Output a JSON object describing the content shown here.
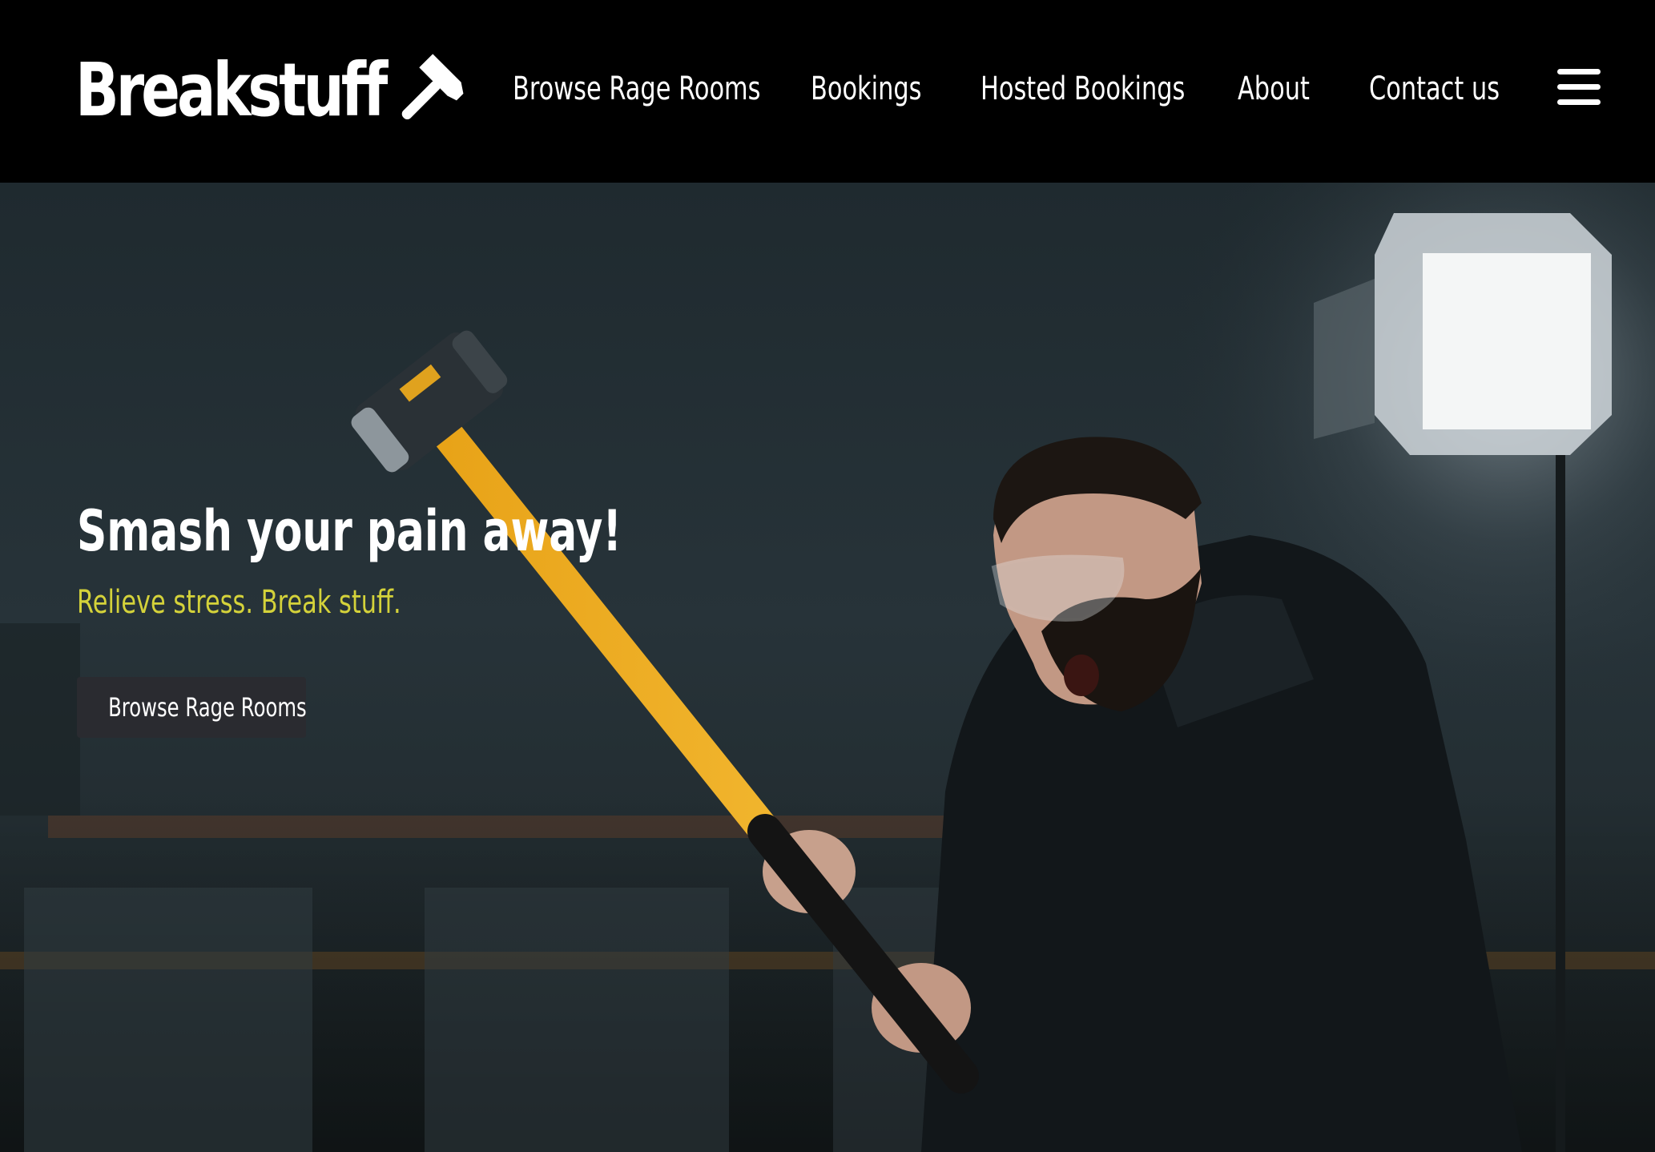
{
  "brand": {
    "name": "Breakstuff",
    "logo_icon": "hammer-icon"
  },
  "nav": {
    "items": [
      {
        "label": "Browse Rage Rooms"
      },
      {
        "label": "Bookings"
      },
      {
        "label": "Hosted Bookings"
      },
      {
        "label": "About"
      },
      {
        "label": "Contact us"
      }
    ],
    "menu_icon": "hamburger-menu-icon"
  },
  "hero": {
    "title": "Smash your pain away!",
    "subtitle": "Relieve stress. Break stuff.",
    "cta_label": "Browse Rage Rooms",
    "background": "video-still-man-swinging-sledgehammer"
  },
  "colors": {
    "header_bg": "#000000",
    "subtitle": "#d4d23a",
    "button_bg": "#2a2b30",
    "text": "#ffffff"
  }
}
